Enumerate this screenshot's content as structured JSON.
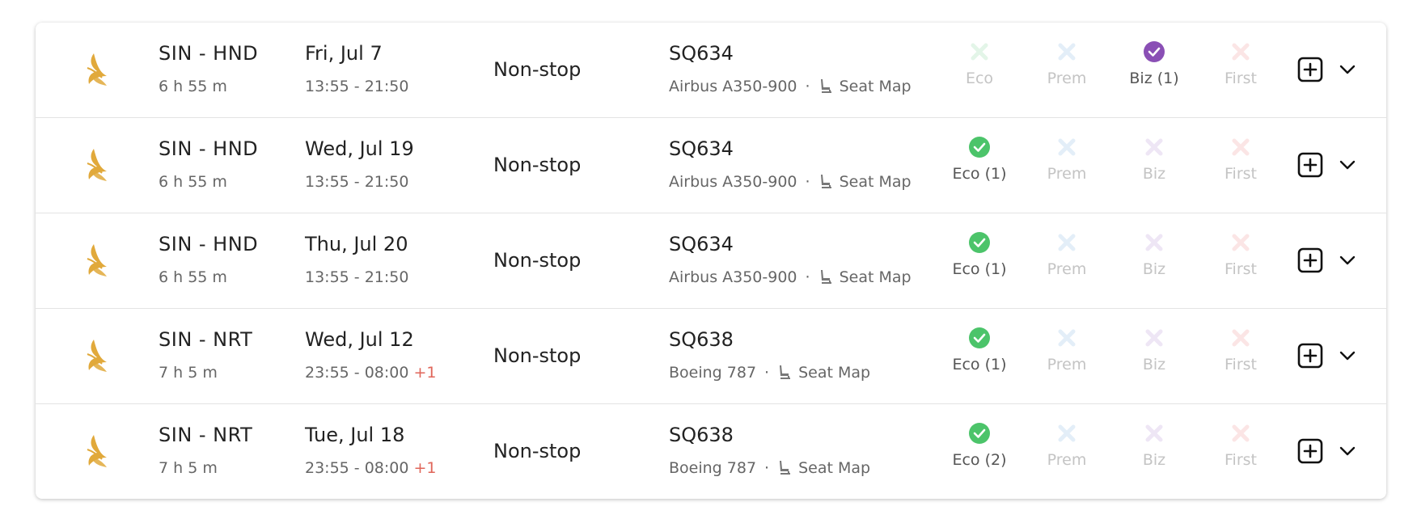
{
  "colors": {
    "available_eco": "#4cc46a",
    "available_biz": "#8a4fb5",
    "x_eco": "#e3f5e8",
    "x_prem": "#e3eef8",
    "x_biz": "#eee6f5",
    "x_first": "#fbe5e5",
    "logo_gold": "#e1a93b"
  },
  "flights": [
    {
      "route": "SIN - HND",
      "duration": "6 h 55 m",
      "date": "Fri, Jul 7",
      "times": "13:55 - 21:50",
      "plus_day": "",
      "stops": "Non-stop",
      "flight_no": "SQ634",
      "aircraft": "Airbus A350-900",
      "seat_map": "Seat Map",
      "cabins": {
        "eco": {
          "label": "Eco",
          "available": false
        },
        "prem": {
          "label": "Prem",
          "available": false
        },
        "biz": {
          "label": "Biz (1)",
          "available": true
        },
        "first": {
          "label": "First",
          "available": false
        }
      }
    },
    {
      "route": "SIN - HND",
      "duration": "6 h 55 m",
      "date": "Wed, Jul 19",
      "times": "13:55 - 21:50",
      "plus_day": "",
      "stops": "Non-stop",
      "flight_no": "SQ634",
      "aircraft": "Airbus A350-900",
      "seat_map": "Seat Map",
      "cabins": {
        "eco": {
          "label": "Eco (1)",
          "available": true
        },
        "prem": {
          "label": "Prem",
          "available": false
        },
        "biz": {
          "label": "Biz",
          "available": false
        },
        "first": {
          "label": "First",
          "available": false
        }
      }
    },
    {
      "route": "SIN - HND",
      "duration": "6 h 55 m",
      "date": "Thu, Jul 20",
      "times": "13:55 - 21:50",
      "plus_day": "",
      "stops": "Non-stop",
      "flight_no": "SQ634",
      "aircraft": "Airbus A350-900",
      "seat_map": "Seat Map",
      "cabins": {
        "eco": {
          "label": "Eco (1)",
          "available": true
        },
        "prem": {
          "label": "Prem",
          "available": false
        },
        "biz": {
          "label": "Biz",
          "available": false
        },
        "first": {
          "label": "First",
          "available": false
        }
      }
    },
    {
      "route": "SIN - NRT",
      "duration": "7 h 5 m",
      "date": "Wed, Jul 12",
      "times": "23:55 - 08:00",
      "plus_day": "+1",
      "stops": "Non-stop",
      "flight_no": "SQ638",
      "aircraft": "Boeing 787",
      "seat_map": "Seat Map",
      "cabins": {
        "eco": {
          "label": "Eco (1)",
          "available": true
        },
        "prem": {
          "label": "Prem",
          "available": false
        },
        "biz": {
          "label": "Biz",
          "available": false
        },
        "first": {
          "label": "First",
          "available": false
        }
      }
    },
    {
      "route": "SIN - NRT",
      "duration": "7 h 5 m",
      "date": "Tue, Jul 18",
      "times": "23:55 - 08:00",
      "plus_day": "+1",
      "stops": "Non-stop",
      "flight_no": "SQ638",
      "aircraft": "Boeing 787",
      "seat_map": "Seat Map",
      "cabins": {
        "eco": {
          "label": "Eco (2)",
          "available": true
        },
        "prem": {
          "label": "Prem",
          "available": false
        },
        "biz": {
          "label": "Biz",
          "available": false
        },
        "first": {
          "label": "First",
          "available": false
        }
      }
    }
  ]
}
